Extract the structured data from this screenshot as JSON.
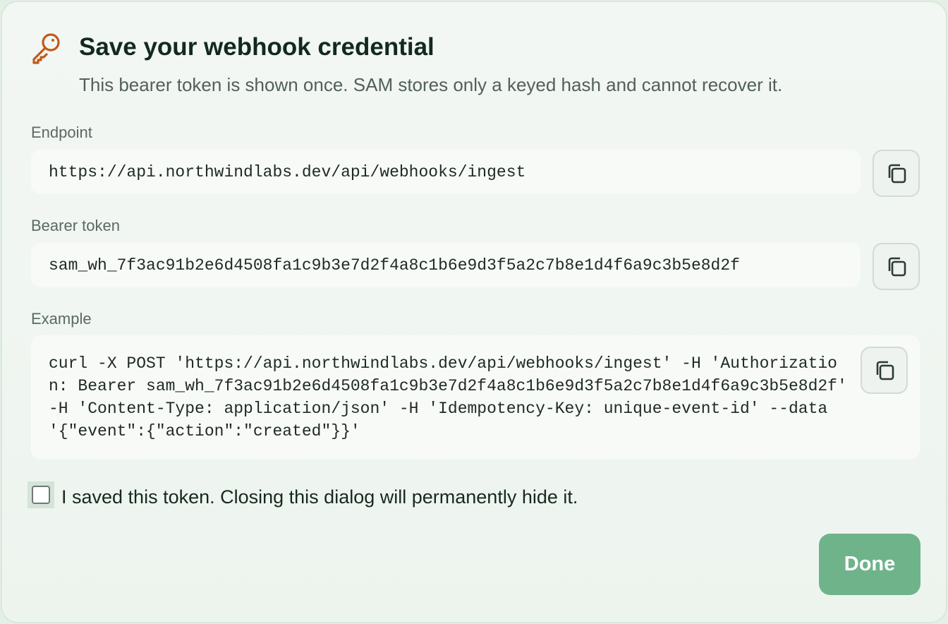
{
  "dialog": {
    "title": "Save your webhook credential",
    "subtitle": "This bearer token is shown once. SAM stores only a keyed hash and cannot recover it."
  },
  "endpoint": {
    "label": "Endpoint",
    "value": "https://api.northwindlabs.dev/api/webhooks/ingest",
    "copy_icon": "copy-icon"
  },
  "token": {
    "label": "Bearer token",
    "value": "sam_wh_7f3ac91b2e6d4508fa1c9b3e7d2f4a8c1b6e9d3f5a2c7b8e1d4f6a9c3b5e8d2f",
    "copy_icon": "copy-icon"
  },
  "example": {
    "label": "Example",
    "code": "curl -X POST 'https://api.northwindlabs.dev/api/webhooks/ingest' -H 'Authorization: Bearer sam_wh_7f3ac91b2e6d4508fa1c9b3e7d2f4a8c1b6e9d3f5a2c7b8e1d4f6a9c3b5e8d2f' -H 'Content-Type: application/json' -H 'Idempotency-Key: unique-event-id' --data '{\"event\":{\"action\":\"created\"}}'",
    "copy_icon": "copy-icon"
  },
  "confirm": {
    "label": "I saved this token. Closing this dialog will permanently hide it.",
    "checked": false
  },
  "actions": {
    "done_label": "Done"
  },
  "colors": {
    "accent_icon": "#c25a1a",
    "primary_button": "#6fb38b",
    "title_text": "#122a1d"
  },
  "icons": {
    "header": "key-icon"
  }
}
